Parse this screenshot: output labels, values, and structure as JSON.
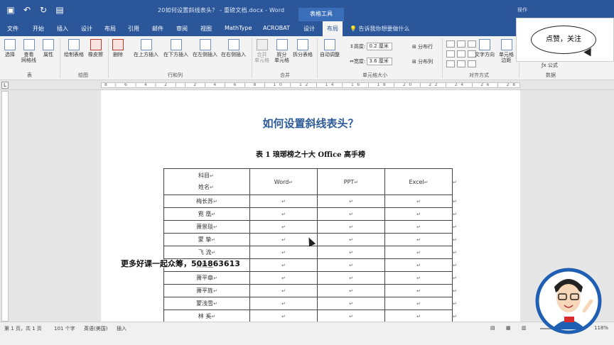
{
  "titlebar": {
    "qat_icons": [
      "save-icon",
      "undo-icon",
      "redo-icon",
      "format-icon"
    ],
    "doc_title": "20如何设置斜线表头？ - 重磅文档.docx  -  Word",
    "context_tab": "表格工具",
    "user": "操作"
  },
  "tabs": [
    "文件",
    "开始",
    "插入",
    "设计",
    "布局",
    "引用",
    "邮件",
    "审阅",
    "视图",
    "MathType",
    "ACROBAT",
    "设计",
    "布局"
  ],
  "active_tab_index": 12,
  "tellme": "告诉我你想要做什么",
  "ribbon": {
    "buttons": {
      "select": "选择",
      "gridlines": "查看\n网格线",
      "properties": "属性",
      "draw_table": "绘制表格",
      "eraser": "橡皮擦",
      "delete": "删除",
      "insert_above": "在上方插入",
      "insert_below": "在下方插入",
      "insert_left": "在左侧插入",
      "insert_right": "在右侧插入",
      "merge_cells": "合并\n单元格",
      "split_cells": "拆分\n单元格",
      "split_table": "拆分表格",
      "autofit": "自动调整",
      "text_direction": "文字方向",
      "cell_margins": "单元格\n边距",
      "formula": "公式"
    },
    "height_label": "高度:",
    "height_value": "0.2 厘米",
    "width_label": "宽度:",
    "width_value": "3.6 厘米",
    "distribute_rows": "分布行",
    "distribute_cols": "分布列",
    "groups": {
      "table": "表",
      "draw": "绘图",
      "rows_cols": "行和列",
      "merge": "合并",
      "cell_size": "单元格大小",
      "alignment": "对齐方式",
      "data": "数据"
    }
  },
  "callout": "点赞，关注",
  "ruler_text": "8 | 6 | 4 | 2 | | 2 | 4 | 6 | 8 | 10 | 12 | 14 | 16 | 18 | 20 | 22 | 24 | 26 | 28 | 30 | 32 | 34 | 36 | 38 | 40 | 42 | 44 | 46 | 48",
  "document": {
    "heading": "如何设置斜线表头？",
    "caption": "表 1  琅琊榜之十大 Office 高手榜",
    "header_top": "科目",
    "header_bottom": "姓名",
    "columns": [
      "Word",
      "PPT",
      "Excel"
    ],
    "rows": [
      "梅长苏",
      "霓    凰",
      "萧景琰",
      "蒙    挚",
      "飞    流",
      "萧庭生",
      "萧平章",
      "萧平旌",
      "蒙浅雪",
      "林    奚"
    ],
    "cell_mark": "↵"
  },
  "overlay_text": "更多好课一起众筹，501863613",
  "status": {
    "page": "第 1 页，共 1 页",
    "words": "101 个字",
    "language": "英语(美国)",
    "mode": "插入",
    "zoom": "118%"
  }
}
